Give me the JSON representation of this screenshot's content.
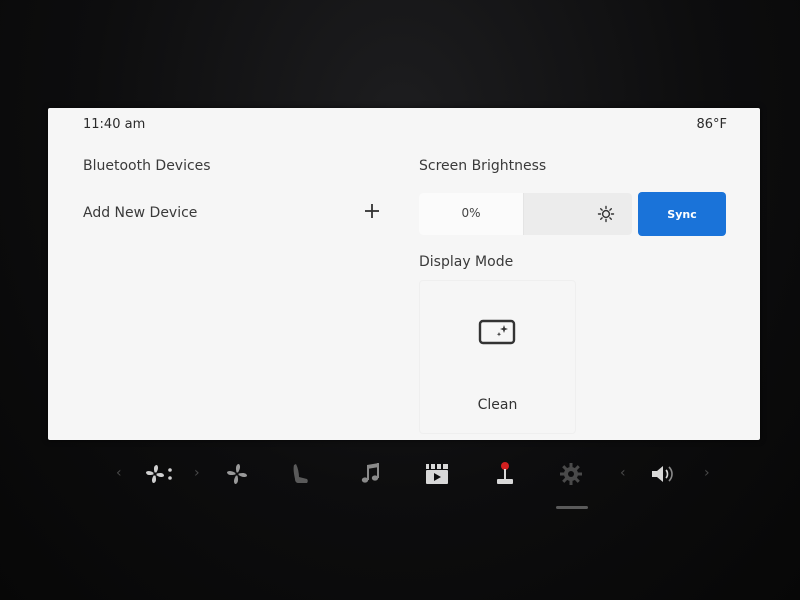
{
  "status": {
    "time": "11:40 am",
    "temperature": "86°F"
  },
  "bluetooth": {
    "title": "Bluetooth Devices",
    "add_label": "Add New Device",
    "add_icon": "plus-icon"
  },
  "brightness": {
    "title": "Screen Brightness",
    "value_label": "0%",
    "level_percent": 0,
    "icon": "sun-icon"
  },
  "sync": {
    "label": "Sync",
    "color": "#1a73d9"
  },
  "display_mode": {
    "title": "Display Mode",
    "option_label": "Clean",
    "icon": "clean-screen-icon"
  },
  "dock": {
    "items": [
      "fan-icon",
      "fan-speed-icon",
      "seat-icon",
      "music-icon",
      "media-icon",
      "joystick-icon",
      "gear-icon",
      "volume-icon"
    ],
    "accent_color": "#d32020"
  }
}
